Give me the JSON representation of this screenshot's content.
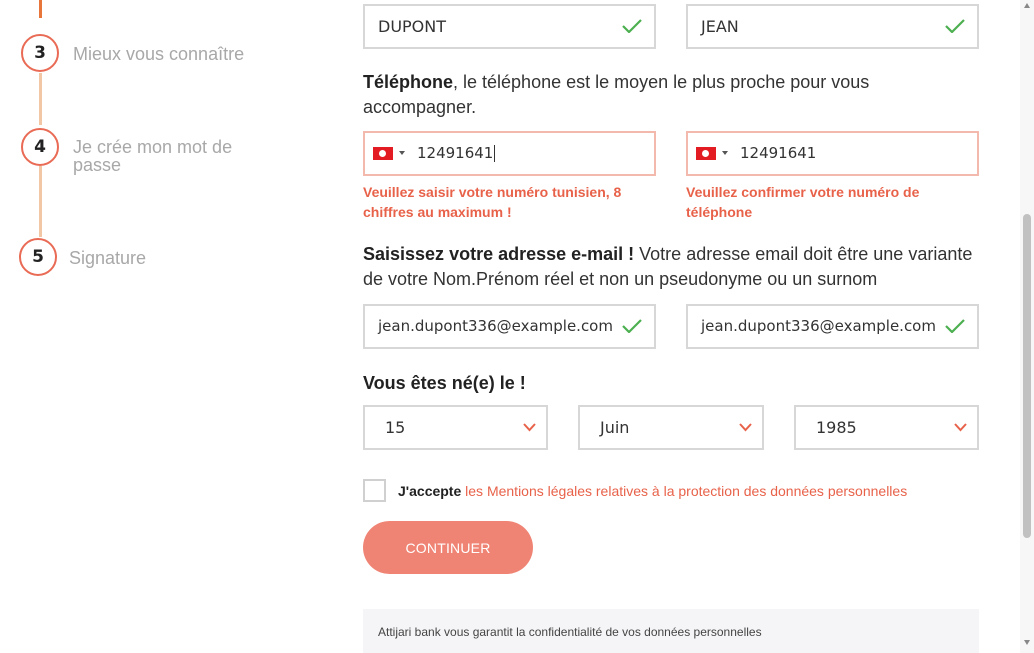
{
  "stepper": {
    "steps": [
      {
        "number": "3",
        "label": "Mieux vous connaître"
      },
      {
        "number": "4",
        "label": "Je crée mon mot de passe"
      },
      {
        "number": "5",
        "label": "Signature"
      }
    ]
  },
  "name": {
    "last_name": "DUPONT",
    "first_name": "JEAN"
  },
  "phone": {
    "heading_bold": "Téléphone",
    "heading_rest": ", le téléphone est le moyen le plus proche pour vous accompagner.",
    "country_icon": "tunisia-flag",
    "number": "12491641",
    "confirm_number": "12491641",
    "error": "Veuillez saisir votre numéro tunisien, 8 chiffres au maximum !",
    "confirm_error": "Veuillez confirmer votre numéro de téléphone"
  },
  "email": {
    "heading_bold": "Saisissez votre adresse e-mail !",
    "heading_rest": " Votre adresse email doit être une variante de votre Nom.Prénom réel et non un pseudonyme ou un surnom",
    "value": "jean.dupont336@example.com",
    "confirm_value": "jean.dupont336@example.com"
  },
  "birth": {
    "heading": "Vous êtes né(e) le !",
    "day": "15",
    "month": "Juin",
    "year": "1985"
  },
  "terms": {
    "accept_label": "J'accepte",
    "link_label": "les Mentions légales relatives à la protection des données personnelles",
    "checked": false
  },
  "actions": {
    "continue_label": "CONTINUER"
  },
  "notice": {
    "text": "Attijari bank vous garantit la confidentialité de vos données personnelles"
  },
  "colors": {
    "accent": "#e96b55",
    "error": "#e8624a",
    "valid": "#4caf50",
    "button": "#f08474"
  }
}
